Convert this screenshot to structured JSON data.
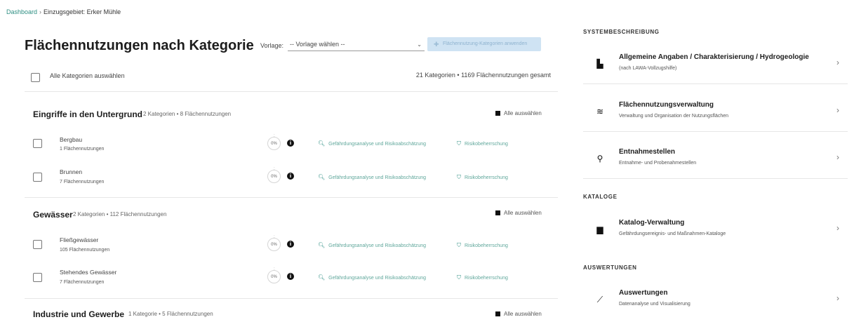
{
  "breadcrumb": {
    "root": "Dashboard",
    "separator": "›",
    "current": "Einzugsgebiet: Erker Mühle"
  },
  "page_title": "Flächennutzungen nach Kategorie",
  "vorlage": {
    "label": "Vorlage:",
    "selected": "-- Vorlage wählen --",
    "apply_button": "Flächennutzung-Kategorien anwenden"
  },
  "select_all_label": "Alle Kategorien auswählen",
  "summary": "21 Kategorien • 1169 Flächennutzungen gesamt",
  "action_labels": {
    "analysis": "Gefährdungsanalyse und Risikoabschätzung",
    "risk": "Risikobeherrschung",
    "select_all_group": "Alle auswählen"
  },
  "groups": [
    {
      "title": "Eingriffe in den Untergrund",
      "meta": "2 Kategorien • 8 Flächennutzungen",
      "rows": [
        {
          "name": "Bergbau",
          "count": "1 Flächennutzungen",
          "progress": "0%"
        },
        {
          "name": "Brunnen",
          "count": "7 Flächennutzungen",
          "progress": "0%"
        }
      ]
    },
    {
      "title": "Gewässer",
      "meta": "2 Kategorien • 112 Flächennutzungen",
      "rows": [
        {
          "name": "Fließgewässer",
          "count": "105 Flächennutzungen",
          "progress": "0%"
        },
        {
          "name": "Stehendes Gewässer",
          "count": "7 Flächennutzungen",
          "progress": "0%"
        }
      ]
    },
    {
      "title": "Industrie und Gewerbe",
      "meta": "1 Kategorie • 5 Flächennutzungen",
      "rows": []
    }
  ],
  "sidebar": {
    "sections": [
      {
        "heading": "SYSTEMBESCHREIBUNG",
        "items": [
          {
            "title": "Allgemeine Angaben / Charakterisierung / Hydrogeologie",
            "subtitle": "(nach LAWA-Vollzugshilfe)",
            "icon": "document-icon"
          },
          {
            "title": "Flächennutzungsverwaltung",
            "subtitle": "Verwaltung und Organisation der Nutzungsflächen",
            "icon": "layers-icon"
          },
          {
            "title": "Entnahmestellen",
            "subtitle": "Entnahme- und Probenahmestellen",
            "icon": "pin-icon"
          }
        ]
      },
      {
        "heading": "KATALOGE",
        "items": [
          {
            "title": "Katalog-Verwaltung",
            "subtitle": "Gefährdungsereignis- und Maßnahmen-Kataloge",
            "icon": "book-icon"
          }
        ]
      },
      {
        "heading": "AUSWERTUNGEN",
        "items": [
          {
            "title": "Auswertungen",
            "subtitle": "Datenanalyse und Visualisierung",
            "icon": "chart-icon"
          }
        ]
      }
    ]
  }
}
